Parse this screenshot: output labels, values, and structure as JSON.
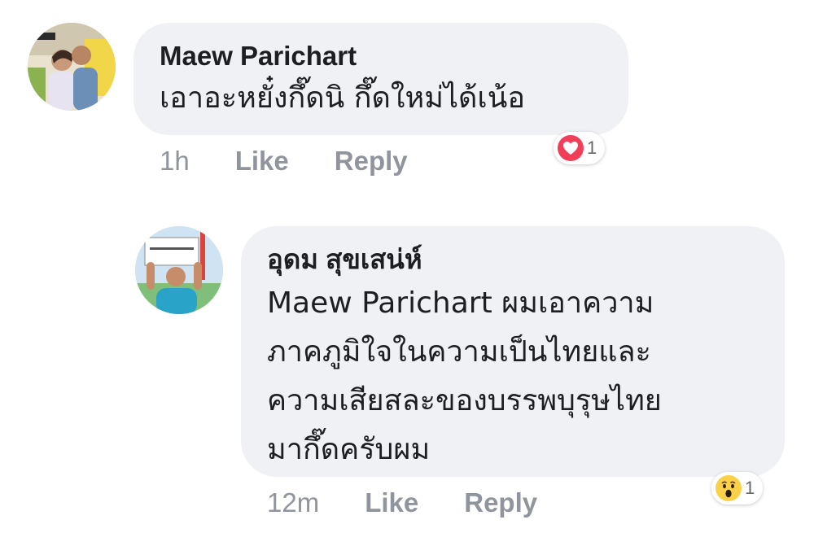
{
  "comments": [
    {
      "author": "Maew Parichart",
      "text": "เอาอะหยั๋งกึ๊ดนิ กึ๊ดใหม่ได้เน้อ",
      "time": "1h",
      "like_label": "Like",
      "reply_label": "Reply",
      "reaction_icon": "heart-icon",
      "reaction_count": "1"
    },
    {
      "author": "อุดม สุขเสน่ห์",
      "text_lines": [
        "Maew Parichart ผมเอาความ",
        "ภาคภูมิใจในความเป็นไทยและ",
        "ความเสียสละของบรรพบุรุษไทย",
        "มากึ๊ดครับผม"
      ],
      "time": "12m",
      "like_label": "Like",
      "reply_label": "Reply",
      "reaction_icon": "wow-face-icon",
      "reaction_count": "1"
    }
  ],
  "colors": {
    "bubble": "#eff1f4",
    "meta_text": "#90949c",
    "heart_red": "#f33e58",
    "wow_yellow": "#fcd049"
  }
}
